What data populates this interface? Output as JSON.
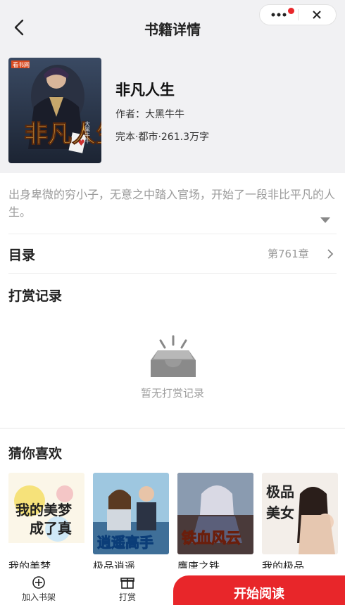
{
  "header": {
    "title": "书籍详情"
  },
  "book": {
    "name": "非凡人生",
    "author": "作者：大黑牛牛",
    "meta": "完本·都市·261.3万字",
    "cover_title": "非凡人生",
    "cover_badge": "看书网",
    "cover_author": "大黑牛牛"
  },
  "description": "出身卑微的穷小子，无意之中踏入官场，开始了一段非比平凡的人生。",
  "toc": {
    "label": "目录",
    "chapter": "第761章"
  },
  "reward": {
    "title": "打赏记录",
    "empty_text": "暂无打赏记录"
  },
  "guess": {
    "title": "猜你喜欢",
    "items": [
      {
        "title": "我的美梦…",
        "cover_text": "我的美梦成了真"
      },
      {
        "title": "极品逍遥…",
        "cover_text": "极品逍遥高手"
      },
      {
        "title": "膺唐之铁…",
        "cover_text": "铁血风云"
      },
      {
        "title": "我的极品…",
        "cover_text": "极品美女们"
      }
    ]
  },
  "bottom": {
    "add_shelf": "加入书架",
    "reward": "打赏",
    "start_read": "开始阅读"
  },
  "colors": {
    "accent": "#e8262a",
    "header_bg": "#f1f1f3",
    "muted_text": "#9a9a9a"
  }
}
